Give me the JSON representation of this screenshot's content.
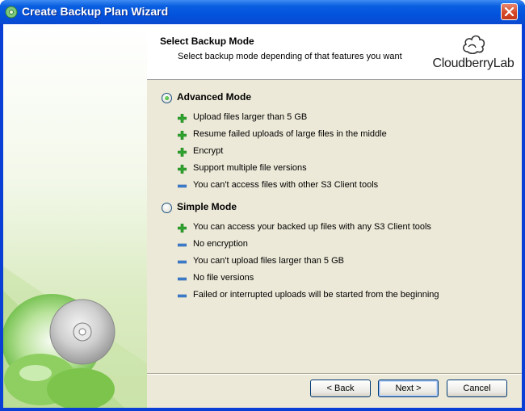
{
  "window": {
    "title": "Create Backup Plan Wizard",
    "icons": {
      "app": "backup-app-icon",
      "close": "close-icon"
    }
  },
  "header": {
    "title": "Select Backup Mode",
    "subtitle": "Select backup mode depending of that features you want",
    "logo_text": "CloudberryLab"
  },
  "modes": [
    {
      "label": "Advanced Mode",
      "selected": true,
      "features": [
        {
          "type": "plus",
          "text": "Upload files larger than 5 GB"
        },
        {
          "type": "plus",
          "text": "Resume failed uploads of large files in the middle"
        },
        {
          "type": "plus",
          "text": "Encrypt"
        },
        {
          "type": "plus",
          "text": "Support multiple file versions"
        },
        {
          "type": "minus",
          "text": "You can't access files with other S3 Client tools"
        }
      ]
    },
    {
      "label": "Simple Mode",
      "selected": false,
      "features": [
        {
          "type": "plus",
          "text": "You can access your backed up files with any S3 Client tools"
        },
        {
          "type": "minus",
          "text": "No encryption"
        },
        {
          "type": "minus",
          "text": "You can't upload files larger than 5 GB"
        },
        {
          "type": "minus",
          "text": "No file versions"
        },
        {
          "type": "minus",
          "text": "Failed or interrupted uploads will be started from the beginning"
        }
      ]
    }
  ],
  "buttons": {
    "back": "< Back",
    "next": "Next >",
    "cancel": "Cancel"
  },
  "colors": {
    "plus": "#2fa52f",
    "minus": "#3d7fd0",
    "titlebar": "#0a5fe0"
  }
}
